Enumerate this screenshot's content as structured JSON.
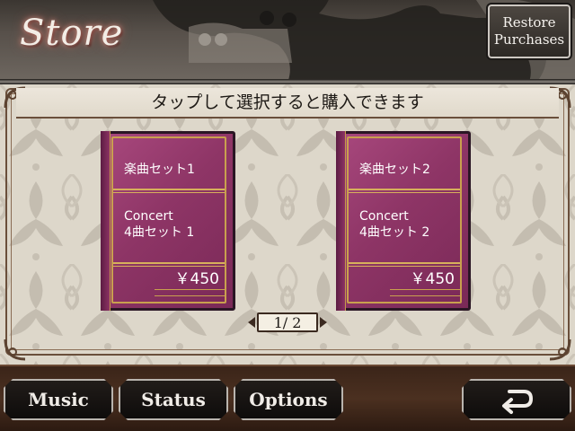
{
  "header": {
    "title": "Store",
    "restore_line1": "Restore",
    "restore_line2": "Purchases"
  },
  "banner": {
    "instruction": "タップして選択すると購入できます"
  },
  "products": [
    {
      "set_name": "楽曲セット1",
      "desc_line1": "Concert",
      "desc_line2": "4曲セット 1",
      "price": "￥450"
    },
    {
      "set_name": "楽曲セット2",
      "desc_line1": "Concert",
      "desc_line2": "4曲セット 2",
      "price": "￥450"
    }
  ],
  "pager": {
    "text": "1/ 2"
  },
  "footer": {
    "music": "Music",
    "status": "Status",
    "options": "Options",
    "back_icon": "return-arrow-icon"
  },
  "colors": {
    "book": "#8e3566",
    "gold": "#c9a04e",
    "header": "#57504a",
    "footer": "#4b3020"
  }
}
